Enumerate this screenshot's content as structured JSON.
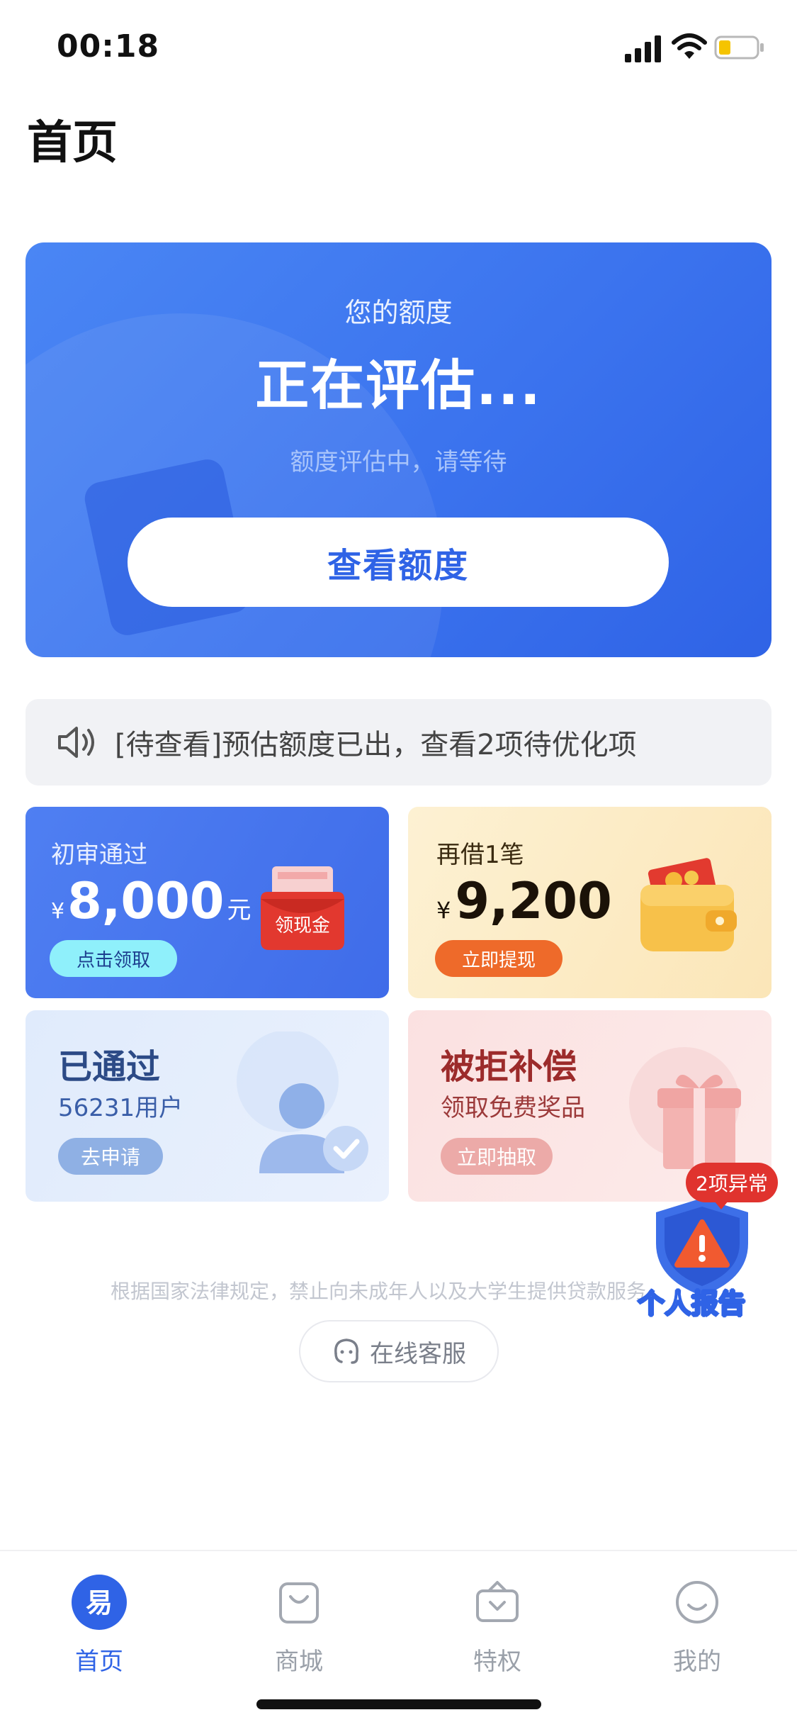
{
  "status_bar": {
    "time": "00:18"
  },
  "header": {
    "title": "首页"
  },
  "quota_card": {
    "label": "您的额度",
    "status": "正在评估...",
    "subtitle": "额度评估中，请等待",
    "button_label": "查看额度"
  },
  "notice": {
    "text": "[待查看]预估额度已出，查看2项待优化项"
  },
  "tiles": {
    "first_review": {
      "caption": "初审通过",
      "currency": "¥",
      "amount": "8,000",
      "unit": "元",
      "button_label": "点击领取",
      "envelope_label": "领现金"
    },
    "borrow_again": {
      "caption": "再借1笔",
      "currency": "¥",
      "amount": "9,200",
      "button_label": "立即提现"
    },
    "approved": {
      "title": "已通过",
      "subtitle": "56231用户",
      "button_label": "去申请"
    },
    "rejected_comp": {
      "title": "被拒补偿",
      "subtitle": "领取免费奖品",
      "button_label": "立即抽取"
    }
  },
  "report_float": {
    "badge": "2项异常",
    "label": "个人报告"
  },
  "disclaimer": "根据国家法律规定，禁止向未成年人以及大学生提供贷款服务",
  "service": {
    "label": "在线客服"
  },
  "tabbar": {
    "items": [
      {
        "label": "首页",
        "icon": "home-logo-icon",
        "active": true
      },
      {
        "label": "商城",
        "icon": "shopping-bag-icon",
        "active": false
      },
      {
        "label": "特权",
        "icon": "privilege-box-icon",
        "active": false
      },
      {
        "label": "我的",
        "icon": "smiley-profile-icon",
        "active": false
      }
    ]
  },
  "colors": {
    "primary": "#2f63e6",
    "card_blue": "#3b73ee",
    "orange": "#ee6a2a",
    "alert_red": "#e0332e"
  }
}
